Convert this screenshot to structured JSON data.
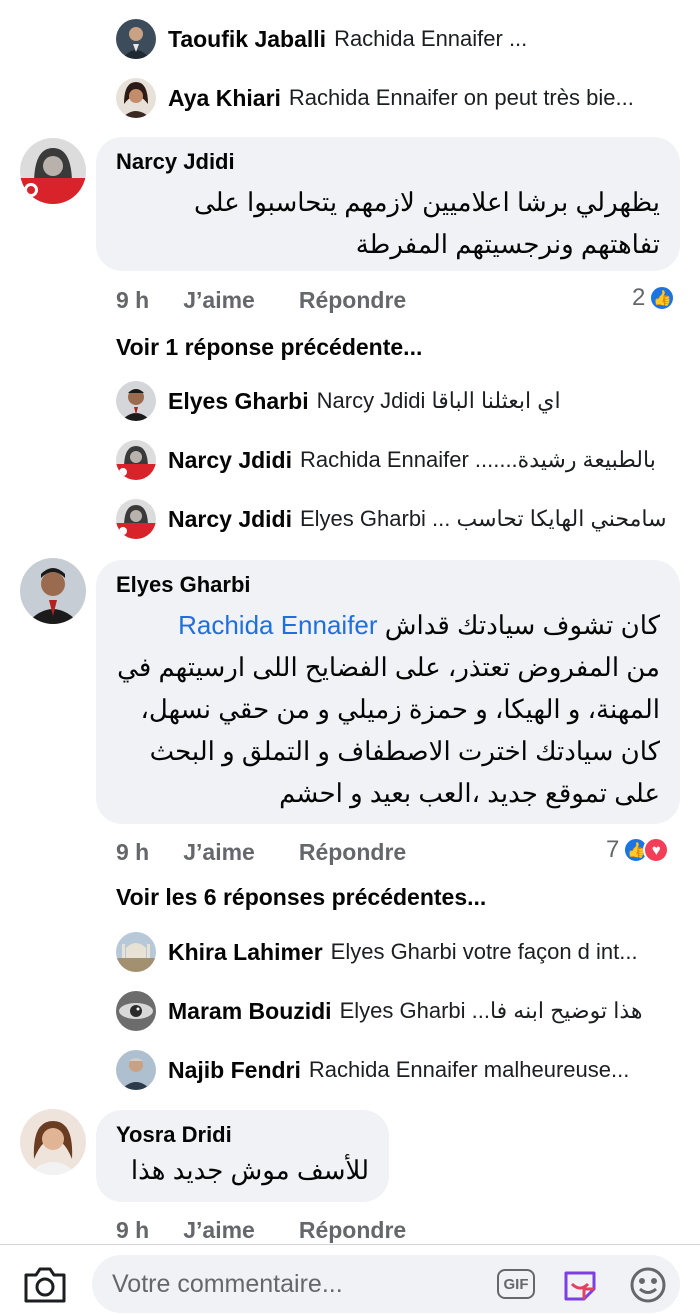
{
  "replies_top": [
    {
      "name": "Taoufik Jaballi",
      "text": "Rachida Ennaifer ..."
    },
    {
      "name": "Aya Khiari",
      "text": "Rachida Ennaifer on peut très bie..."
    }
  ],
  "comment1": {
    "author": "Narcy Jdidi",
    "line1": "يظهرلي برشا اعلاميين لازمهم يتحاسبوا على",
    "line2": "تفاهتهم ونرجسيتهم المفرطة",
    "time": "9 h",
    "like_label": "J’aime",
    "reply_label": "Répondre",
    "reaction_count": "2",
    "reactions": [
      "like-icon"
    ],
    "view_more": "Voir 1 réponse précédente..."
  },
  "replies_c1": [
    {
      "name": "Elyes Gharbi",
      "text": "Narcy Jdidi اي ابعثلنا الباقا"
    },
    {
      "name": "Narcy Jdidi",
      "text": "Rachida Ennaifer .......بالطبيعة رشيدة"
    },
    {
      "name": "Narcy Jdidi",
      "text": "Elyes Gharbi ... سامحني الهايكا تحاسب"
    }
  ],
  "comment2": {
    "author": "Elyes Gharbi",
    "mention": "Rachida Ennaifer",
    "line1": "كان تشوف سيادتك قداش",
    "line2": "من المفروض تعتذر، على الفضايح اللى ارسيتهم في",
    "line3": "المهنة، و الهيكا، و حمزة زميلي و من حقي نسهل،",
    "line4": "كان سيادتك اخترت الاصطفاف و التملق و البحث",
    "line5": "على تموقع جديد ،العب بعيد و احشم",
    "time": "9 h",
    "like_label": "J’aime",
    "reply_label": "Répondre",
    "reaction_count": "7",
    "reactions": [
      "like-icon",
      "heart-icon"
    ],
    "view_more": "Voir les 6 réponses précédentes..."
  },
  "replies_c2": [
    {
      "name": "Khira Lahimer",
      "text": "Elyes Gharbi votre façon d int..."
    },
    {
      "name": "Maram Bouzidi",
      "text": "Elyes Gharbi ...هذا توضيح ابنه فا"
    },
    {
      "name": "Najib Fendri",
      "text": "Rachida Ennaifer malheureuse..."
    }
  ],
  "comment3": {
    "author": "Yosra Dridi",
    "line1": "للأسف موش جديد هذا",
    "time": "9 h",
    "like_label": "J’aime",
    "reply_label": "Répondre"
  },
  "composer": {
    "placeholder": "Votre commentaire...",
    "gif_label": "GIF"
  },
  "colors": {
    "bubble": "#f0f2f5",
    "mention": "#216fdb",
    "meta_gray": "#65676b",
    "like_blue": "#1b74e4",
    "heart_red": "#f33e58"
  }
}
